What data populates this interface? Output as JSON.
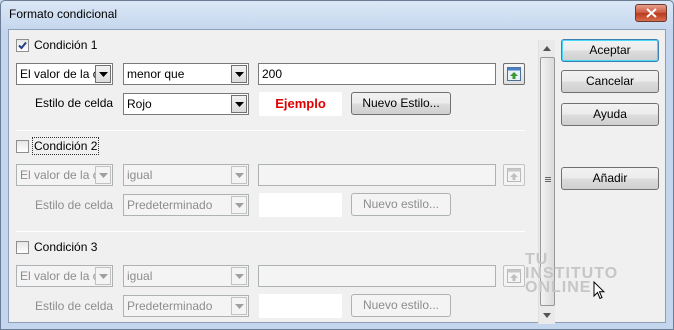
{
  "window": {
    "title": "Formato condicional"
  },
  "conditions": [
    {
      "label": "Condición 1",
      "checked": true,
      "type_value": "El valor de la c",
      "operator_value": "menor que",
      "value": "200",
      "style_label": "Estilo de celda",
      "style_value": "Rojo",
      "preview_text": "Ejemplo",
      "preview_color": "#e00000",
      "new_style_label": "Nuevo Estilo..."
    },
    {
      "label": "Condición 2",
      "checked": false,
      "type_value": "El valor de la c",
      "operator_value": "igual",
      "value": "",
      "style_label": "Estilo de celda",
      "style_value": "Predeterminado",
      "preview_text": "",
      "new_style_label": "Nuevo estilo..."
    },
    {
      "label": "Condición 3",
      "checked": false,
      "type_value": "El valor de la c",
      "operator_value": "igual",
      "value": "",
      "style_label": "Estilo de celda",
      "style_value": "Predeterminado",
      "preview_text": "",
      "new_style_label": "Nuevo estilo..."
    }
  ],
  "buttons": {
    "accept": "Aceptar",
    "cancel": "Cancelar",
    "help": "Ayuda",
    "add": "Añadir"
  },
  "watermark": {
    "line1": "TU",
    "line2": "INSTITUTO",
    "line3": "ONLINE"
  },
  "icons": {
    "close": "close-icon",
    "shrink": "shrink-dialog-icon",
    "dropdown": "chevron-down-icon",
    "check": "checkmark-icon"
  },
  "colors": {
    "accent": "#3c7fb1",
    "preview_text": "#e00000"
  }
}
